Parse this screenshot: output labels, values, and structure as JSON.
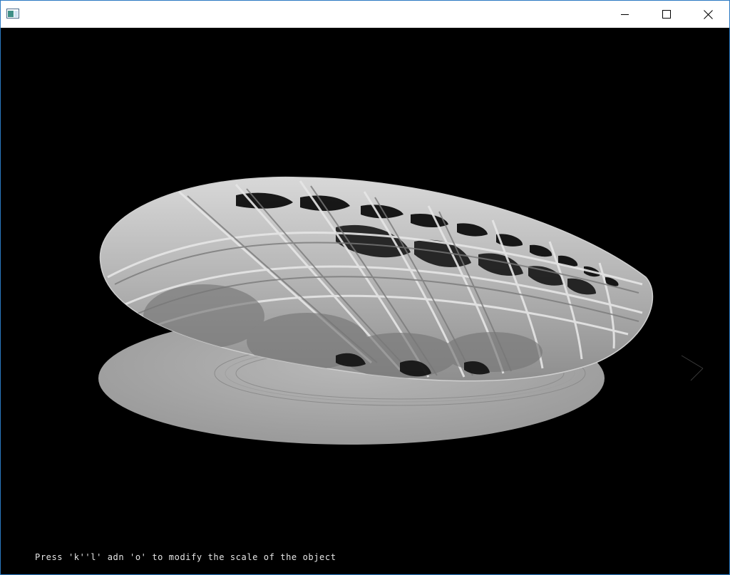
{
  "window": {
    "title": "",
    "controls": {
      "minimize": "minimize-icon",
      "maximize": "maximize-icon",
      "close": "close-icon"
    }
  },
  "viewport": {
    "background": "#000000",
    "object": "lattice-torus-on-plate",
    "hint_text": "Press 'k''l' adn 'o' to modify the scale of the object"
  }
}
